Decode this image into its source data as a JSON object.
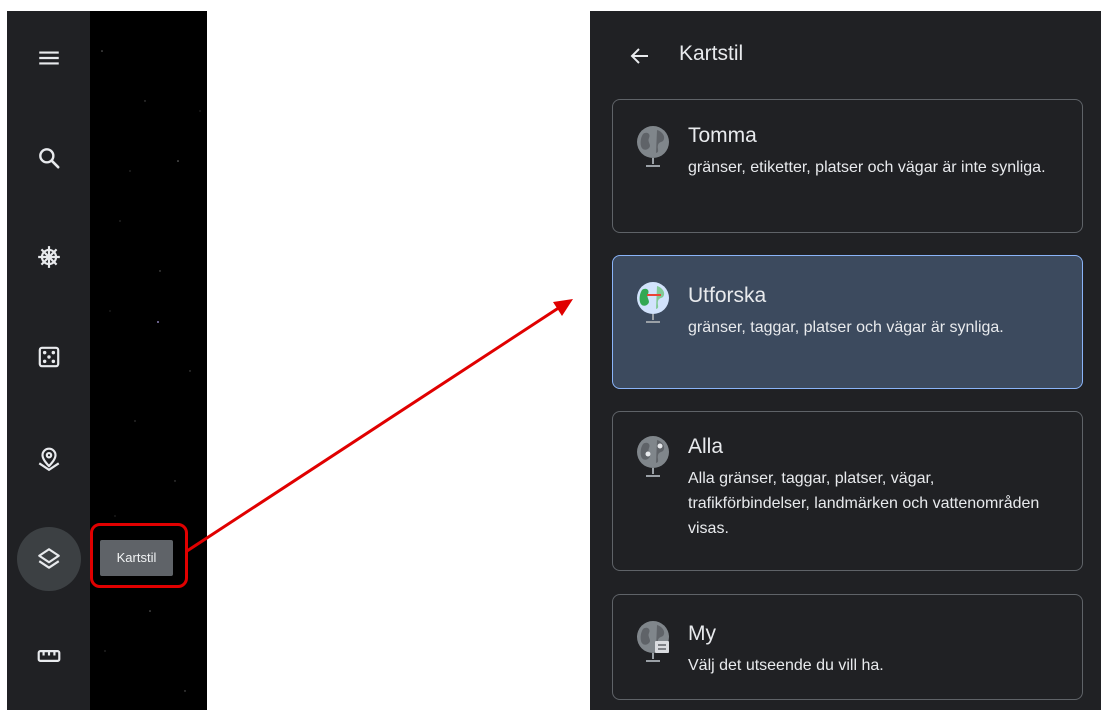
{
  "rail": {
    "items": [
      {
        "icon": "menu-icon"
      },
      {
        "icon": "search-icon"
      },
      {
        "icon": "voyager-icon"
      },
      {
        "icon": "dice-icon"
      },
      {
        "icon": "projects-icon"
      },
      {
        "icon": "layers-icon",
        "active": true
      },
      {
        "icon": "ruler-icon"
      }
    ],
    "tooltip": "Kartstil"
  },
  "panel": {
    "title": "Kartstil",
    "styles": [
      {
        "name": "Tomma",
        "desc": "gränser, etiketter, platser och vägar är inte synliga.",
        "icon": "globe-gray-icon"
      },
      {
        "name": "Utforska",
        "desc": "gränser, taggar, platser och vägar är synliga.",
        "icon": "globe-color-icon",
        "selected": true
      },
      {
        "name": "Alla",
        "desc": "Alla gränser, taggar, platser, vägar, trafikförbindelser, landmärken och vattenområden visas.",
        "icon": "globe-pins-icon"
      },
      {
        "name": "My",
        "desc": "Välj det utseende du vill ha.",
        "icon": "globe-custom-icon"
      }
    ]
  },
  "colors": {
    "panel_bg": "#202124",
    "selected_bg": "#3c4a5e",
    "selected_border": "#8ab4f8",
    "annotation": "#e00000"
  }
}
